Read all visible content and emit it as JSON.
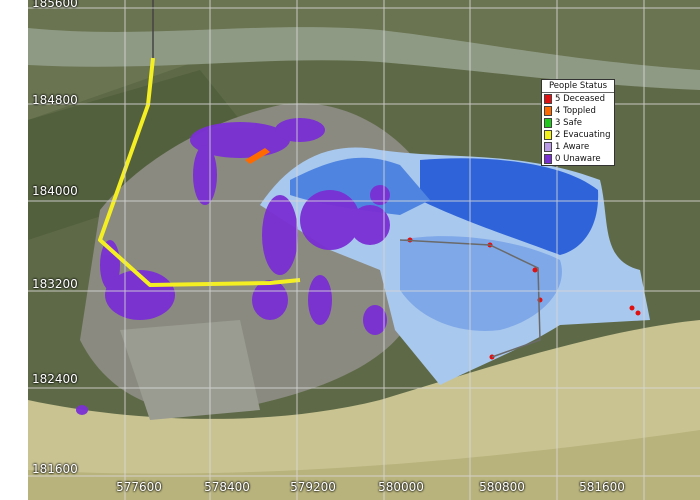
{
  "map": {
    "y_ticks": [
      "185600",
      "184800",
      "184000",
      "183200",
      "182400",
      "181600"
    ],
    "x_ticks": [
      "577600",
      "578400",
      "579200",
      "580000",
      "580800",
      "581600"
    ],
    "legend": {
      "title": "People Status",
      "items": [
        {
          "label": "5 Deceased",
          "color": "#e01010"
        },
        {
          "label": "4 Toppled",
          "color": "#ff6a00"
        },
        {
          "label": "3 Safe",
          "color": "#22c81e"
        },
        {
          "label": "2 Evacuating",
          "color": "#f2f21a"
        },
        {
          "label": "1 Aware",
          "color": "#b99be8"
        },
        {
          "label": "0 Unaware",
          "color": "#7a2fd4"
        }
      ]
    },
    "colors": {
      "land": "#5e6a47",
      "town": "#8a8a80",
      "river": "#8f9a84",
      "sea": "#c9c392",
      "flood_deep": "#2f63d9",
      "flood_shallow": "#a9c8ee",
      "evacuation_route": "#f4ef22",
      "unaware": "#7a2fd4",
      "deceased": "#e01010",
      "grid": "#d8d8d8"
    }
  }
}
